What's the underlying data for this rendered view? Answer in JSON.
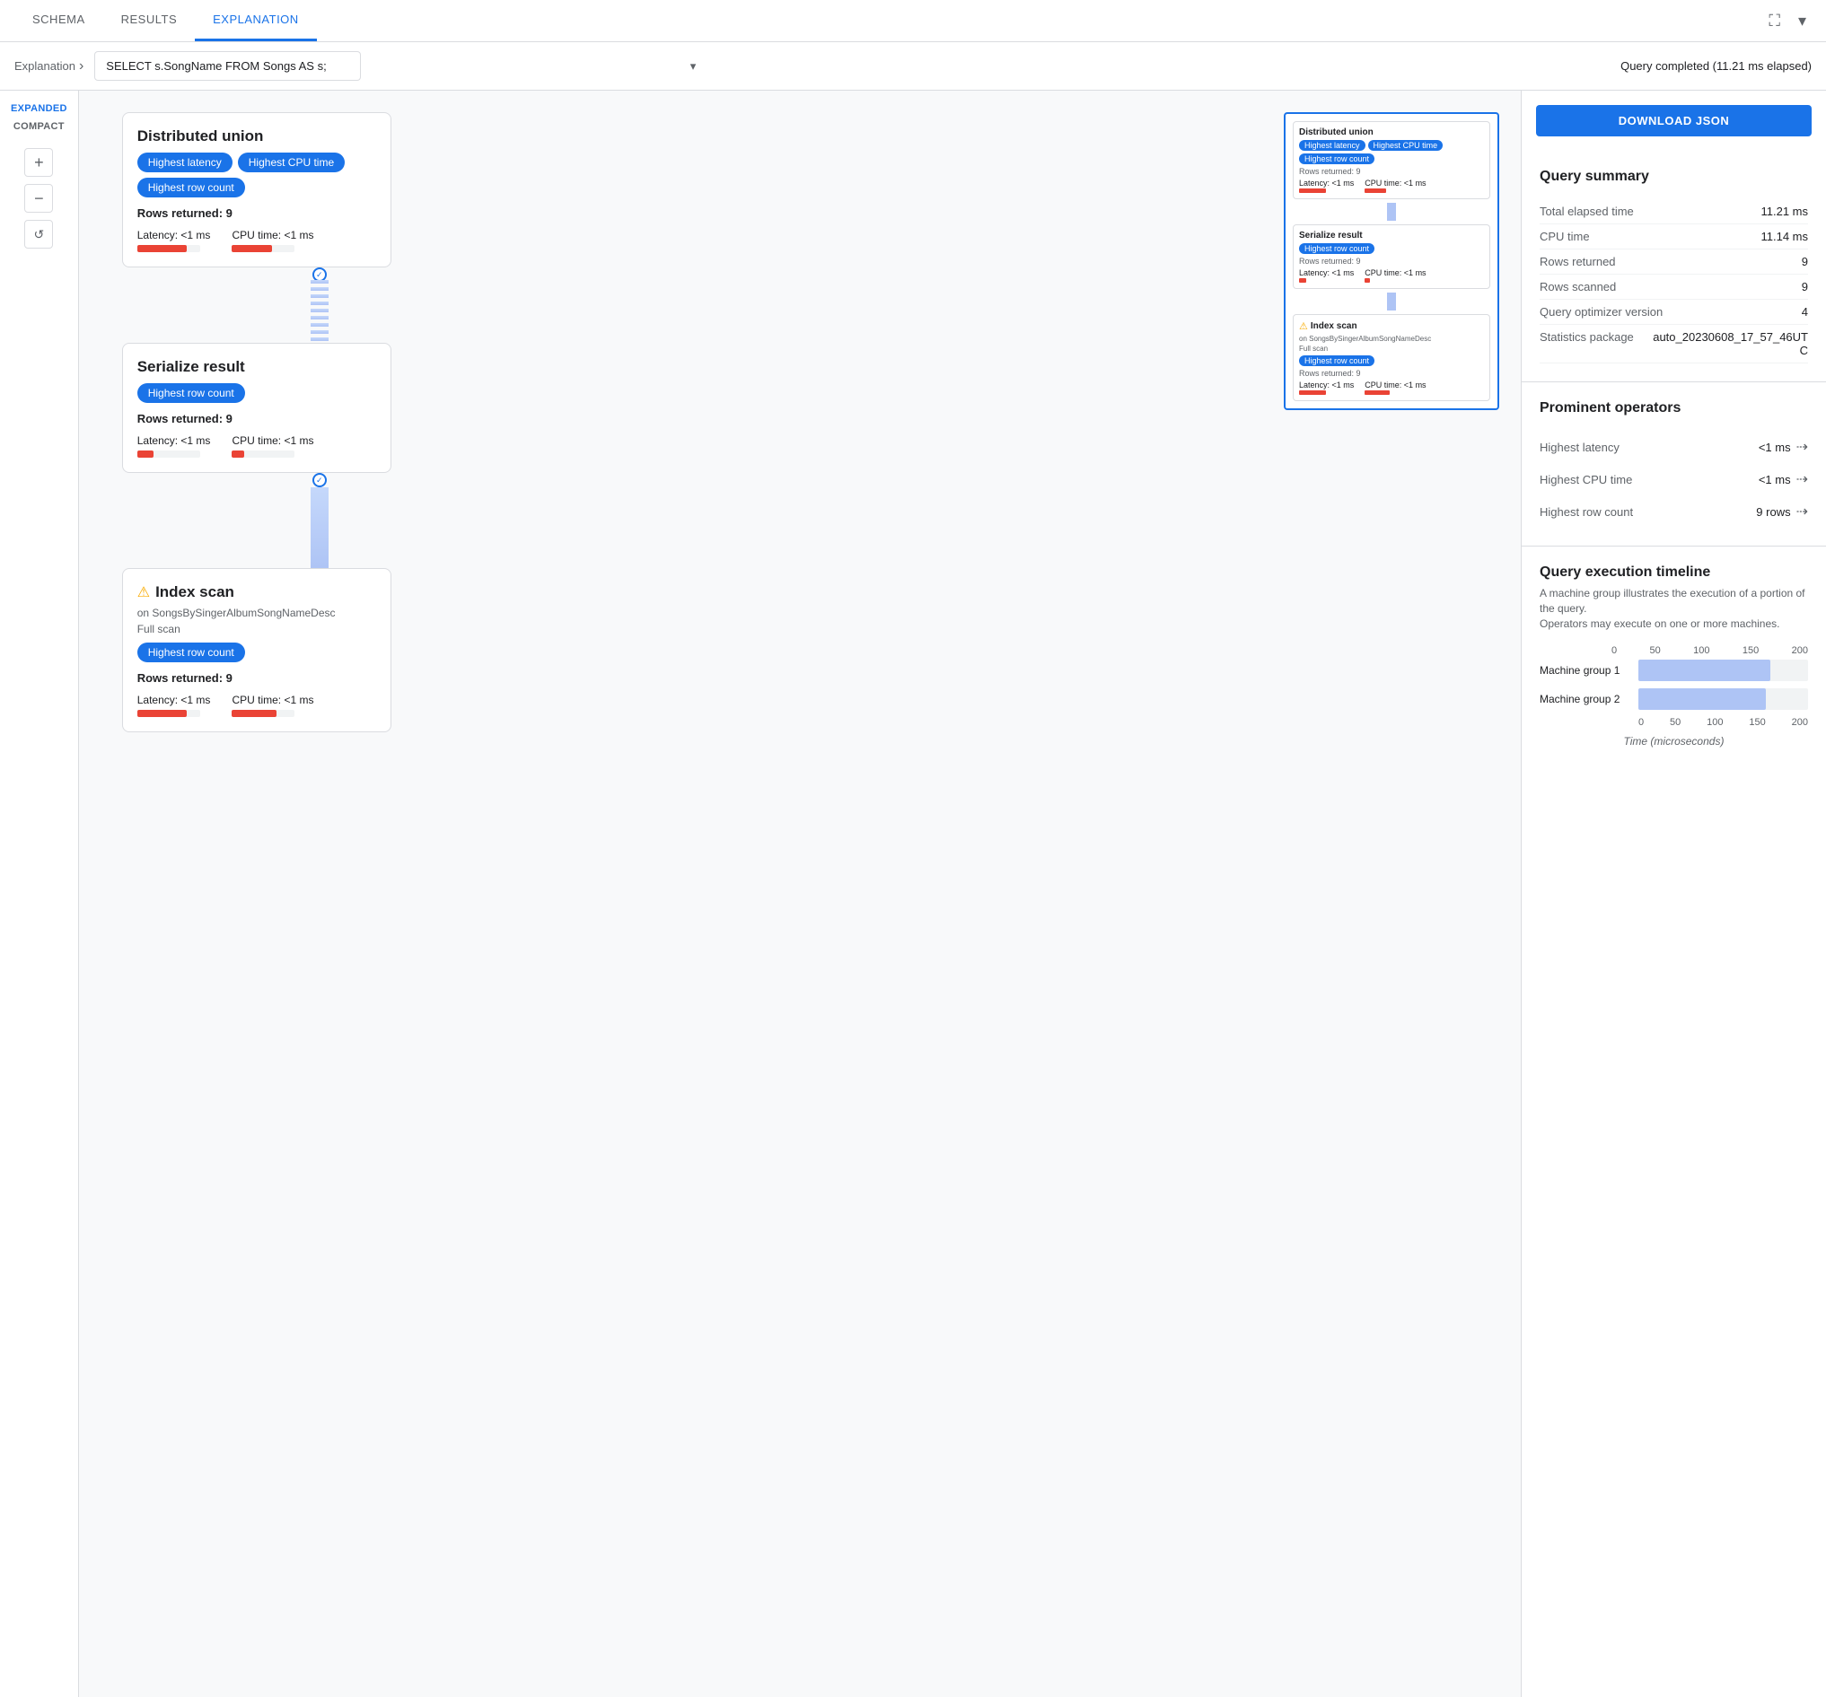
{
  "tabs": {
    "items": [
      {
        "label": "SCHEMA",
        "active": false
      },
      {
        "label": "RESULTS",
        "active": false
      },
      {
        "label": "EXPLANATION",
        "active": true
      }
    ]
  },
  "query_bar": {
    "breadcrumb": "Explanation",
    "query_text": "SELECT s.SongName FROM Songs AS s;",
    "status": "Query completed (11.21 ms elapsed)"
  },
  "toolbar": {
    "expanded_label": "EXPANDED",
    "compact_label": "COMPACT",
    "download_label": "DOWNLOAD JSON"
  },
  "nodes": [
    {
      "id": "distributed_union",
      "title": "Distributed union",
      "badges": [
        "Highest latency",
        "Highest CPU time",
        "Highest row count"
      ],
      "rows": "Rows returned: 9",
      "latency": "Latency: <1 ms",
      "cpu_time": "CPU time: <1 ms",
      "bar1_width": "55",
      "bar2_width": "45"
    },
    {
      "id": "serialize_result",
      "title": "Serialize result",
      "badges": [
        "Highest row count"
      ],
      "rows": "Rows returned: 9",
      "latency": "Latency: <1 ms",
      "cpu_time": "CPU time: <1 ms",
      "bar1_width": "18",
      "bar2_width": "14"
    },
    {
      "id": "index_scan",
      "title": "Index scan",
      "warning": true,
      "subtitle_on": "on SongsBySingerAlbumSongNameDesc",
      "subtitle_full": "Full scan",
      "badges": [
        "Highest row count"
      ],
      "rows": "Rows returned: 9",
      "latency": "Latency: <1 ms",
      "cpu_time": "CPU time: <1 ms",
      "bar1_width": "55",
      "bar2_width": "50"
    }
  ],
  "query_summary": {
    "title": "Query summary",
    "rows": [
      {
        "key": "Total elapsed time",
        "val": "11.21 ms"
      },
      {
        "key": "CPU time",
        "val": "11.14 ms"
      },
      {
        "key": "Rows returned",
        "val": "9"
      },
      {
        "key": "Rows scanned",
        "val": "9"
      },
      {
        "key": "Query optimizer version",
        "val": "4"
      },
      {
        "key": "Statistics package",
        "val": "auto_20230608_17_57_46UTC"
      }
    ]
  },
  "prominent_operators": {
    "title": "Prominent operators",
    "rows": [
      {
        "key": "Highest latency",
        "val": "<1 ms"
      },
      {
        "key": "Highest CPU time",
        "val": "<1 ms"
      },
      {
        "key": "Highest row count",
        "val": "9 rows"
      }
    ]
  },
  "timeline": {
    "title": "Query execution timeline",
    "desc1": "A machine group illustrates the execution of a portion of the query.",
    "desc2": "Operators may execute on one or more machines.",
    "axis_labels": [
      "0",
      "50",
      "100",
      "150",
      "200"
    ],
    "bars": [
      {
        "label": "Machine group 1",
        "width_pct": 78
      },
      {
        "label": "Machine group 2",
        "width_pct": 75
      }
    ],
    "axis_title": "Time (microseconds)"
  },
  "minimap": {
    "nodes": [
      {
        "title": "Distributed union",
        "badges": [
          "Highest latency",
          "Highest CPU time",
          "Highest row count"
        ]
      },
      {
        "title": "Serialize result",
        "badges": [
          "Highest row count"
        ]
      },
      {
        "title": "Index scan",
        "badges": [
          "Highest row count"
        ]
      }
    ]
  }
}
